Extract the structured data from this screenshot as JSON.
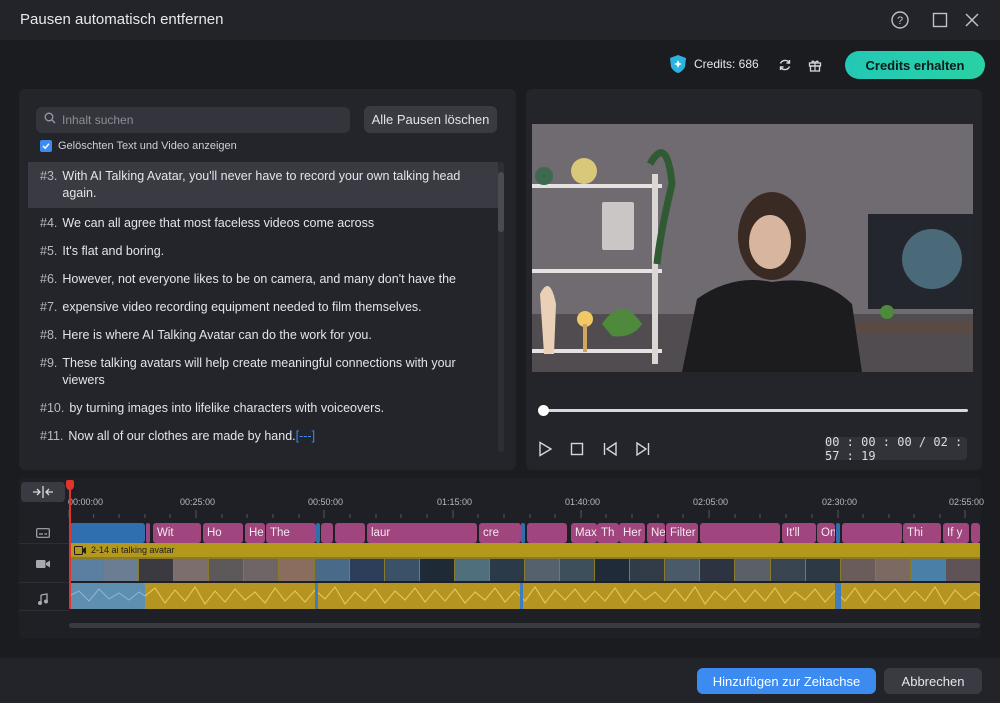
{
  "window": {
    "title": "Pausen automatisch entfernen"
  },
  "header": {
    "credits_label": "Credits: 686",
    "get_credits_label": "Credits erhalten"
  },
  "left": {
    "search_placeholder": "Inhalt suchen",
    "clear_button_label": "Alle Pausen löschen",
    "show_deleted_label": "Gelöschten Text und Video anzeigen",
    "show_deleted_checked": true,
    "items": [
      {
        "num": "#3.",
        "text": "With AI Talking Avatar, you'll never have to record your own talking head again.",
        "active": true
      },
      {
        "num": "#4.",
        "text": "We can all agree that most faceless videos come across"
      },
      {
        "num": "#5.",
        "text": "It's flat and boring."
      },
      {
        "num": "#6.",
        "text": "However, not everyone likes to be on camera, and many don't have the"
      },
      {
        "num": "#7.",
        "text": "expensive video recording equipment needed to film themselves."
      },
      {
        "num": "#8.",
        "text": "Here is where AI Talking Avatar can do the work for you."
      },
      {
        "num": "#9.",
        "text": "These talking avatars will help create meaningful connections with your viewers"
      },
      {
        "num": "#10.",
        "text": "by turning images into lifelike characters with voiceovers."
      },
      {
        "num": "#11.",
        "text": "Now all of our clothes are made by hand.",
        "extra": "[---]"
      }
    ]
  },
  "player": {
    "time_display": "00 : 00 : 00 / 02 : 57 : 19",
    "progress": 0
  },
  "timeline": {
    "ticks": [
      "00:00:00",
      "00:25:00",
      "00:50:00",
      "01:15:00",
      "01:40:00",
      "02:05:00",
      "02:30:00",
      "02:55:00"
    ],
    "video_clip_label": "2-14 ai talking avatar",
    "subtitle_segments": [
      "Wit",
      "Ho",
      "He",
      "The",
      "laur",
      "cre",
      "Max",
      "Th",
      "Her",
      "Ne",
      "Filter",
      "It'll",
      "On",
      "Thi",
      "If y"
    ]
  },
  "footer": {
    "add_label": "Hinzufügen zur Zeitachse",
    "cancel_label": "Abbrechen"
  },
  "colors": {
    "accent": "#3b8bf0",
    "credits_button": "#29d1a4",
    "subtitle_clip": "#a0457d",
    "audio_clip": "#9a7d1c",
    "playhead": "#e0342f"
  }
}
